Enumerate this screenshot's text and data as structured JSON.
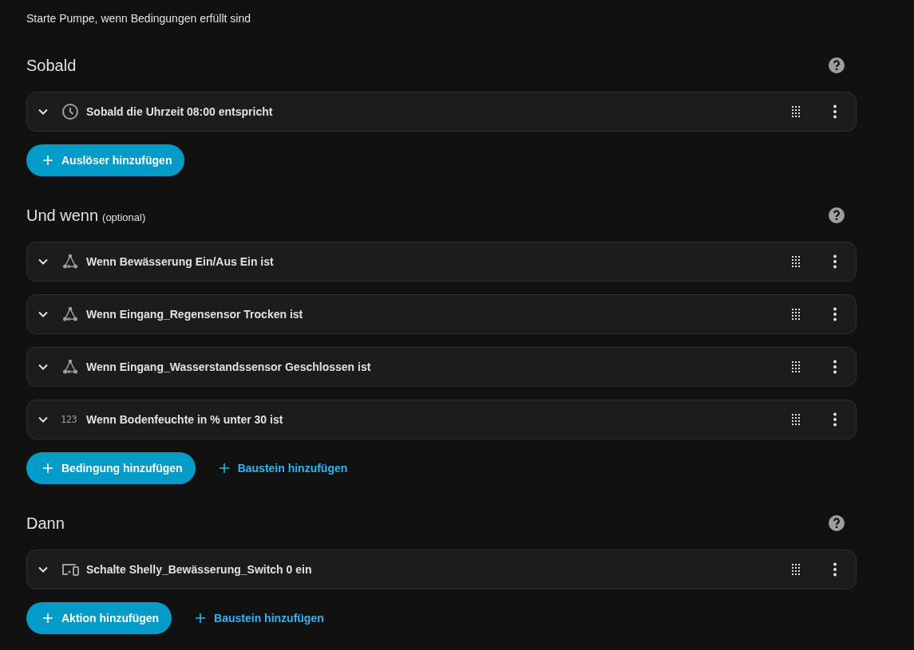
{
  "description": "Starte Pumpe, wenn Bedingungen erfüllt sind",
  "sections": [
    {
      "title": "Sobald",
      "rows": [
        {
          "kind": "clock",
          "text": "Sobald die Uhrzeit 08:00 entspricht"
        }
      ],
      "buttons": [
        {
          "kind": "primary",
          "label": "Auslöser hinzufügen"
        }
      ]
    },
    {
      "title": "Und wenn",
      "optional_note": "(optional)",
      "rows": [
        {
          "kind": "state",
          "text": "Wenn Bewässerung Ein/Aus Ein ist"
        },
        {
          "kind": "state",
          "text": "Wenn Eingang_Regensensor Trocken ist"
        },
        {
          "kind": "state",
          "text": "Wenn Eingang_Wasserstandssensor Geschlossen ist"
        },
        {
          "kind": "numeric",
          "icon_text": "123",
          "text": "Wenn Bodenfeuchte in % unter 30 ist"
        }
      ],
      "buttons": [
        {
          "kind": "primary",
          "label": "Bedingung hinzufügen"
        },
        {
          "kind": "text",
          "label": "Baustein hinzufügen"
        }
      ]
    },
    {
      "title": "Dann",
      "rows": [
        {
          "kind": "device",
          "text": "Schalte Shelly_Bewässerung_Switch 0 ein"
        }
      ],
      "buttons": [
        {
          "kind": "primary",
          "label": "Aktion hinzufügen"
        },
        {
          "kind": "text",
          "label": "Baustein hinzufügen"
        }
      ]
    }
  ]
}
